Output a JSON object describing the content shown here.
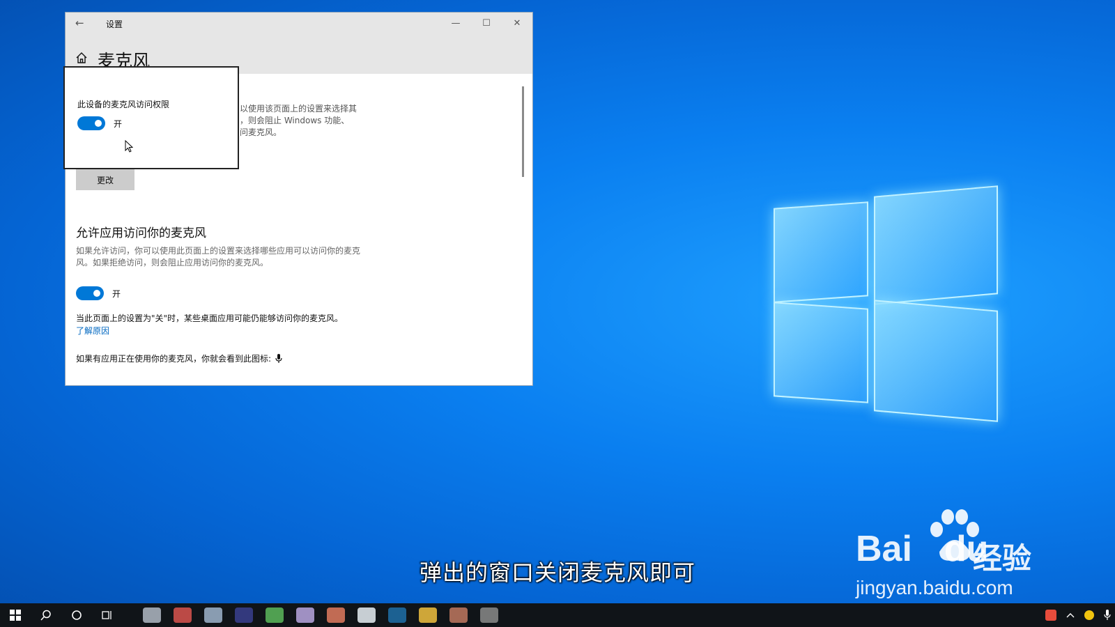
{
  "window": {
    "app_title": "设置",
    "page_title": "麦克风"
  },
  "popup": {
    "title": "此设备的麦克风访问权限",
    "toggle_label": "开",
    "toggle_state": true
  },
  "device_section": {
    "desc_partial": "以使用该页面上的设置来选择其\n，则会阻止 Windows 功能、\n问麦克风。",
    "change_label": "更改"
  },
  "apps_section": {
    "heading": "允许应用访问你的麦克风",
    "description": "如果允许访问，你可以使用此页面上的设置来选择哪些应用可以访问你的麦克风。如果拒绝访问，则会阻止应用访问你的麦克风。",
    "toggle_label": "开",
    "toggle_state": true,
    "note": "当此页面上的设置为\"关\"时，某些桌面应用可能仍能够访问你的麦克风。",
    "learn_more": "了解原因",
    "mic_note": "如果有应用正在使用你的麦克风，你就会看到此图标:"
  },
  "subtitle": "弹出的窗口关闭麦克风即可",
  "watermark": {
    "brand": "Bai",
    "brand_du": "du",
    "cn": "经验",
    "url": "jingyan.baidu.com"
  },
  "taskbar": {
    "apps": [
      {
        "icon": "app-icon-1",
        "color": "#b0b8c4"
      },
      {
        "icon": "chrome-icon",
        "color": "#d9534f"
      },
      {
        "icon": "app-icon-3",
        "color": "#9fb4cc"
      },
      {
        "icon": "app-icon-4",
        "color": "#3a3f8f"
      },
      {
        "icon": "app-icon-5",
        "color": "#5cb85c"
      },
      {
        "icon": "app-icon-6",
        "color": "#b9a6e0"
      },
      {
        "icon": "app-icon-7",
        "color": "#e07a5f"
      },
      {
        "icon": "app-icon-8",
        "color": "#e8eef5"
      },
      {
        "icon": "photoshop-icon",
        "color": "#1f6fa8"
      },
      {
        "icon": "folder-icon",
        "color": "#f0c040"
      },
      {
        "icon": "app-icon-11",
        "color": "#c07860"
      },
      {
        "icon": "settings-icon",
        "color": "#8a8a8a"
      }
    ]
  },
  "colors": {
    "accent": "#0078d7",
    "link": "#0067c0"
  }
}
